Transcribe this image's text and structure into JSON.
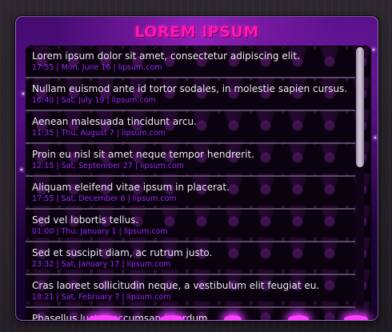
{
  "widget": {
    "title": "LOREM IPSUM"
  },
  "feed": {
    "items": [
      {
        "title": "Lorem ipsum dolor sit amet, consectetur adipiscing elit.",
        "meta": "17:55 | Mon, June 16 | lipsum.com"
      },
      {
        "title": "Nullam euismod ante id tortor sodales, in molestie sapien cursus.",
        "meta": "16:40 | Sat, July 19 | lipsum.com"
      },
      {
        "title": "Aenean malesuada tincidunt arcu.",
        "meta": "11:35 | Thu, August 7 | lipsum.com"
      },
      {
        "title": "Proin eu nisl sit amet neque tempor hendrerit.",
        "meta": "12:15 | Sat, September 27 | lipsum.com"
      },
      {
        "title": "Aliquam eleifend vitae ipsum in placerat.",
        "meta": "17:55 | Sat, December 6 | lipsum.com"
      },
      {
        "title": "Sed vel lobortis tellus.",
        "meta": "01:00 | Thu, January 1 | lipsum.com"
      },
      {
        "title": "Sed et suscipit diam, ac rutrum justo.",
        "meta": "23:32 | Sat, January 17 | lipsum.com"
      },
      {
        "title": "Cras laoreet sollicitudin neque, a vestibulum elit feugiat eu.",
        "meta": "18:21 | Sat, February 7 | lipsum.com"
      },
      {
        "title": "Phasellus luctus accumsan interdum.",
        "meta": ""
      }
    ]
  },
  "colors": {
    "title": "#ff18b8",
    "item_text": "#efe8f2",
    "meta_text": "#8f2ce8",
    "accent_glow": "#ff3cff"
  }
}
